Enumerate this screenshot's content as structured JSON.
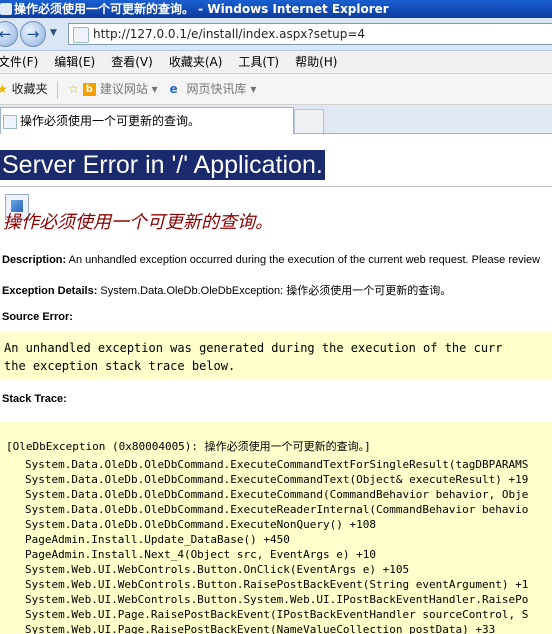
{
  "window": {
    "title": "操作必须使用一个可更新的查询。 - Windows Internet Explorer"
  },
  "address": {
    "url": "http://127.0.0.1/e/install/index.aspx?setup=4"
  },
  "menu": [
    "文件(F)",
    "编辑(E)",
    "查看(V)",
    "收藏夹(A)",
    "工具(T)",
    "帮助(H)"
  ],
  "favorites": {
    "label": "收藏夹",
    "suggested_sites": "建议网站 ▾",
    "web_slice": "网页快讯库 ▾"
  },
  "tab": {
    "title": "操作必须使用一个可更新的查询。"
  },
  "page": {
    "error_title": "Server Error in '/' Application.",
    "error_message": "操作必须使用一个可更新的查询。",
    "description_label": "Description:",
    "description_text": "An unhandled exception occurred during the execution of the current web request. Please review",
    "exception_label": "Exception Details:",
    "exception_text": "System.Data.OleDb.OleDbException: 操作必须使用一个可更新的查询。",
    "source_error_label": "Source Error:",
    "source_error_lines": [
      "An unhandled exception was generated during the execution of the curr",
      "the exception stack trace below."
    ],
    "stack_trace_label": "Stack Trace:",
    "stack_header": "[OleDbException (0x80004005): 操作必须使用一个可更新的查询。]",
    "stack_lines": [
      "System.Data.OleDb.OleDbCommand.ExecuteCommandTextForSingleResult(tagDBPARAMS",
      "System.Data.OleDb.OleDbCommand.ExecuteCommandText(Object& executeResult) +19",
      "System.Data.OleDb.OleDbCommand.ExecuteCommand(CommandBehavior behavior, Obje",
      "System.Data.OleDb.OleDbCommand.ExecuteReaderInternal(CommandBehavior behavio",
      "System.Data.OleDb.OleDbCommand.ExecuteNonQuery() +108",
      "PageAdmin.Install.Update_DataBase() +450",
      "PageAdmin.Install.Next_4(Object src, EventArgs e) +10",
      "System.Web.UI.WebControls.Button.OnClick(EventArgs e) +105",
      "System.Web.UI.WebControls.Button.RaisePostBackEvent(String eventArgument) +1",
      "System.Web.UI.WebControls.Button.System.Web.UI.IPostBackEventHandler.RaisePo",
      "System.Web.UI.Page.RaisePostBackEvent(IPostBackEventHandler sourceControl, S",
      "System.Web.UI.Page.RaisePostBackEvent(NameValueCollection postData) +33"
    ]
  }
}
